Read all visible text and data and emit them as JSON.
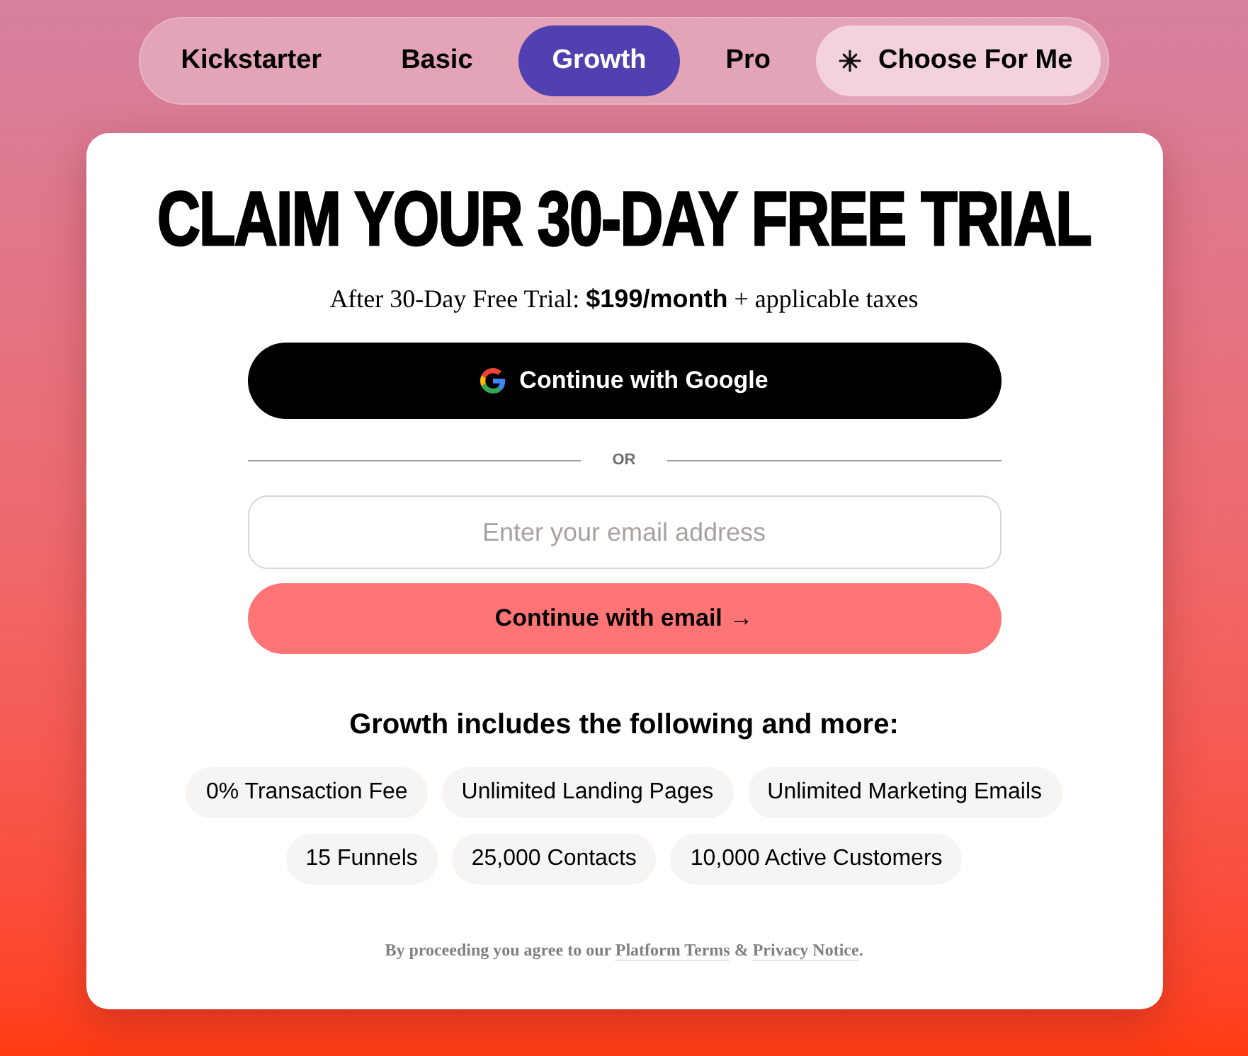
{
  "tabs": [
    {
      "label": "Kickstarter",
      "selected": false,
      "kind": "plan"
    },
    {
      "label": "Basic",
      "selected": false,
      "kind": "plan"
    },
    {
      "label": "Growth",
      "selected": true,
      "kind": "plan"
    },
    {
      "label": "Pro",
      "selected": false,
      "kind": "plan"
    },
    {
      "label": "Choose For Me",
      "selected": false,
      "kind": "picker"
    }
  ],
  "card": {
    "title": "CLAIM YOUR 30-DAY FREE TRIAL",
    "subtitle": "After 30-Day Free Trial: **$199/month** + applicable taxes",
    "google_button": "Continue with Google",
    "divider": "OR",
    "email_field": {
      "placeholder": "Enter your email address"
    },
    "email_button": "Continue with email →",
    "features_heading": "Growth includes the following and more:",
    "features": [
      "0% Transaction Fee",
      "Unlimited Landing Pages",
      "Unlimited Marketing Emails",
      "15 Funnels",
      "25,000 Contacts",
      "10,000 Active Customers"
    ],
    "legal": {
      "prefix": "By proceeding you agree to our",
      "links": [
        "Platform Terms",
        "Privacy Notice"
      ],
      "separator": "&",
      "suffix": "."
    }
  }
}
